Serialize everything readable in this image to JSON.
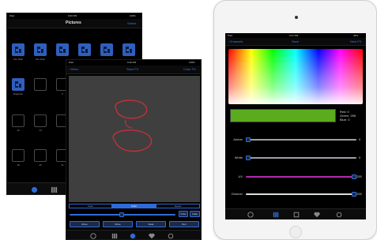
{
  "back_device": {
    "status_left": "iPad",
    "status_time": "9:00 PM",
    "status_right": "100%",
    "nav_title": "Pictures",
    "nav_right": "Select",
    "tile_labels_row1": [
      "Fire Rain",
      "Fire Rain",
      "",
      "",
      "",
      ""
    ],
    "tile_labels_row2": [
      "Ragtrace",
      "",
      "3",
      "9",
      "",
      ""
    ],
    "tile_labels_row3": [
      "12",
      "14",
      "",
      "",
      "",
      ""
    ],
    "tile_labels_row4": [
      "19",
      "20",
      "21",
      "",
      "",
      ""
    ]
  },
  "fx_device": {
    "status_left": "iPad",
    "status_time": "9:49 PM",
    "status_right": "100%",
    "nav_back": "Menu",
    "nav_title": "Save FX",
    "nav_right": "Color FX",
    "segments": [
      "Color",
      "Color",
      "Speed"
    ],
    "side_buttons": [
      "Color",
      "Fade"
    ],
    "bottom_buttons": [
      "Move",
      "Move",
      "Fade",
      "Run"
    ]
  },
  "ipad": {
    "status_left": "iPad",
    "status_time": "3:27 PM",
    "status_right": "45%",
    "nav_back": "Channels",
    "nav_title": "Save",
    "nav_right": "New FX",
    "swatch_color": "#5aab1e",
    "rgb_red": "Red: 0",
    "rgb_green": "Green: 255",
    "rgb_blue": "Blue: 0",
    "sliders": [
      {
        "label": "Amber",
        "value": "0",
        "level": 0.0,
        "fill": "#9aa0a6"
      },
      {
        "label": "White",
        "value": "0",
        "level": 0.0,
        "fill": "#9aa0a6"
      },
      {
        "label": "UV",
        "value": "255",
        "level": 1.0,
        "fill": "#b02bb0"
      },
      {
        "label": "Dimmer",
        "value": "255",
        "level": 1.0,
        "fill": "#dcdcdc"
      }
    ],
    "tab_icons": [
      "palette-icon",
      "sliders-icon",
      "effects-icon",
      "heart-icon",
      "settings-icon"
    ],
    "accent": "#2f6bd8"
  }
}
